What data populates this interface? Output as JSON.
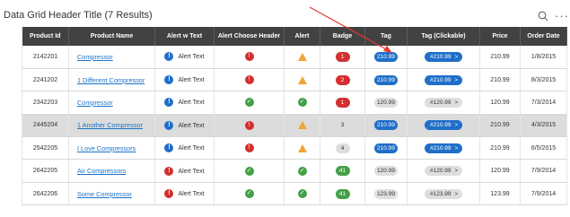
{
  "header": {
    "title": "Data Grid Header Title (7 Results)",
    "search_icon": "search-icon",
    "more_icon": "more-horizontal-icon",
    "more_glyph": "···"
  },
  "columns": [
    "Product Id",
    "Product Name",
    "Alert w Text",
    "Alert Choose Header",
    "Alert",
    "Badge",
    "Tag",
    "Tag (Clickable)",
    "Price",
    "Order Date"
  ],
  "colors": {
    "header_bg": "#424242",
    "link": "#1a73c8",
    "blue": "#1f6fc9",
    "red": "#d32f2f",
    "green": "#43a047",
    "amber": "#f0a43a",
    "selected_row": "#dcdcdc",
    "arrow": "#e53935"
  },
  "rows": [
    {
      "id": "2142201",
      "name": "Compressor",
      "alert_text_icon": "!",
      "alert_text": "Alert Text",
      "choose_icon": "!",
      "choose_symbol": "!",
      "alert_icon": "warning-triangle-icon",
      "badge": "1",
      "tag": "210.99",
      "ctag": "#210.99",
      "ctag_chevron": ">",
      "price": "210.99",
      "date": "1/8/2015"
    },
    {
      "id": "2241202",
      "name": "1 Different Compressor",
      "alert_text_icon": "!",
      "alert_text": "Alert Text",
      "choose_icon": "!",
      "choose_symbol": "!",
      "alert_icon": "warning-triangle-icon",
      "badge": "2",
      "tag": "210.99",
      "ctag": "#210.99",
      "ctag_chevron": ">",
      "price": "210.99",
      "date": "8/3/2015"
    },
    {
      "id": "2342203",
      "name": "Compressor",
      "alert_text_icon": "!",
      "alert_text": "Alert Text",
      "choose_icon": "check",
      "choose_symbol": "✓",
      "alert_icon": "check-circle-icon",
      "badge": "1",
      "tag": "120.99",
      "ctag": "#120.99",
      "ctag_chevron": ">",
      "price": "120.99",
      "date": "7/3/2014"
    },
    {
      "id": "2445204",
      "name": "1 Another Compressor",
      "alert_text_icon": "!",
      "alert_text": "Alert Text",
      "choose_icon": "!",
      "choose_symbol": "!",
      "alert_icon": "warning-triangle-icon",
      "badge": "3",
      "tag": "210.99",
      "ctag": "#210.99",
      "ctag_chevron": ">",
      "price": "210.99",
      "date": "4/3/2015"
    },
    {
      "id": "2542205",
      "name": "I Love Compressors",
      "alert_text_icon": "!",
      "alert_text": "Alert Text",
      "choose_icon": "!",
      "choose_symbol": "!",
      "alert_icon": "warning-triangle-icon",
      "badge": "4",
      "tag": "210.99",
      "ctag": "#210.99",
      "ctag_chevron": ">",
      "price": "210.99",
      "date": "6/5/2015"
    },
    {
      "id": "2642205",
      "name": "Air Compressors",
      "alert_text_icon": "!",
      "alert_text": "Alert Text",
      "choose_icon": "check",
      "choose_symbol": "✓",
      "alert_icon": "check-circle-icon",
      "badge": "41",
      "tag": "120.99",
      "ctag": "#120.99",
      "ctag_chevron": ">",
      "price": "120.99",
      "date": "7/9/2014"
    },
    {
      "id": "2642206",
      "name": "Some Compressor",
      "alert_text_icon": "!",
      "alert_text": "Alert Text",
      "choose_icon": "check",
      "choose_symbol": "✓",
      "alert_icon": "check-circle-icon",
      "badge": "41",
      "tag": "123.99",
      "ctag": "#123.99",
      "ctag_chevron": ">",
      "price": "123.99",
      "date": "7/9/2014"
    }
  ]
}
